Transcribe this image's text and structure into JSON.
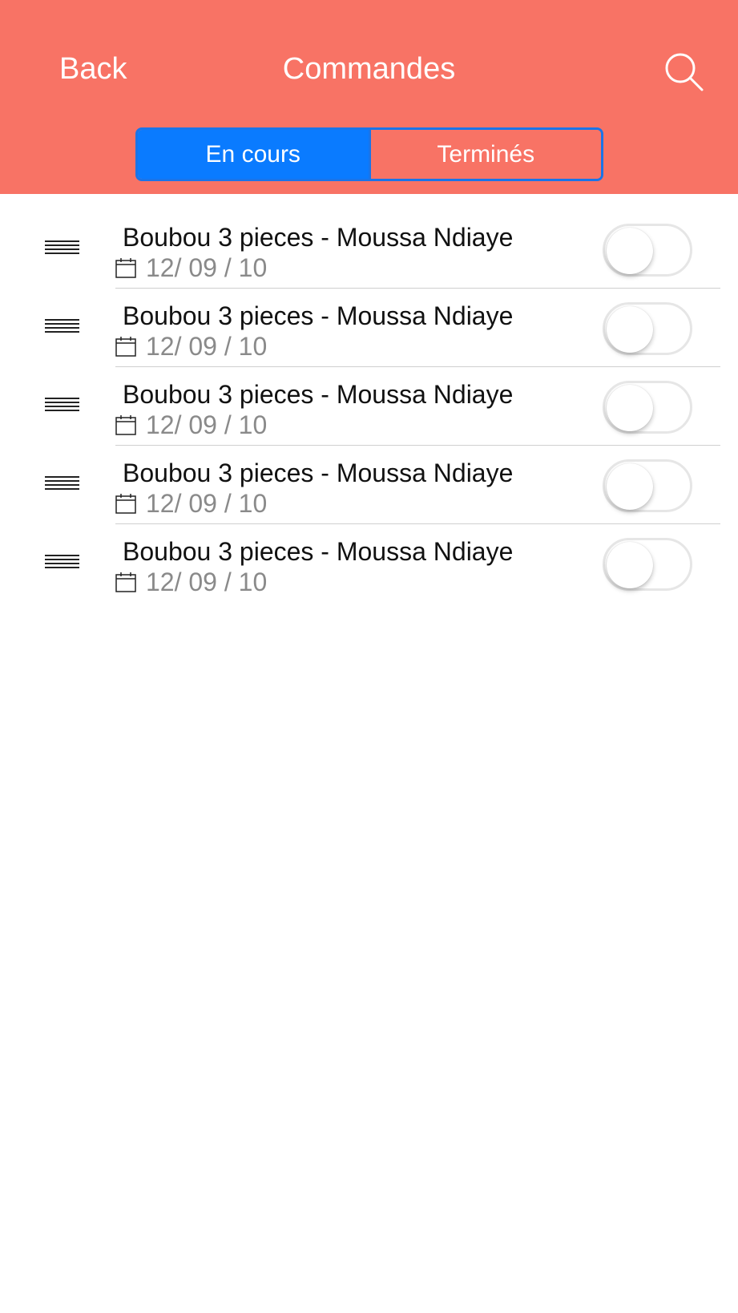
{
  "header": {
    "back_label": "Back",
    "title": "Commandes",
    "accent_color": "#F87365"
  },
  "segment": {
    "active_label": "En cours",
    "inactive_label": "Terminés",
    "active_color": "#0A7BFF"
  },
  "orders": [
    {
      "name": "Boubou 3 pieces - Moussa Ndiaye",
      "date": "12/ 09 / 10",
      "toggled": false
    },
    {
      "name": "Boubou 3 pieces - Moussa Ndiaye",
      "date": "12/ 09 / 10",
      "toggled": false
    },
    {
      "name": "Boubou 3 pieces - Moussa Ndiaye",
      "date": "12/ 09 / 10",
      "toggled": false
    },
    {
      "name": "Boubou 3 pieces - Moussa Ndiaye",
      "date": "12/ 09 / 10",
      "toggled": false
    },
    {
      "name": "Boubou 3 pieces - Moussa Ndiaye",
      "date": "12/ 09 / 10",
      "toggled": false
    }
  ]
}
